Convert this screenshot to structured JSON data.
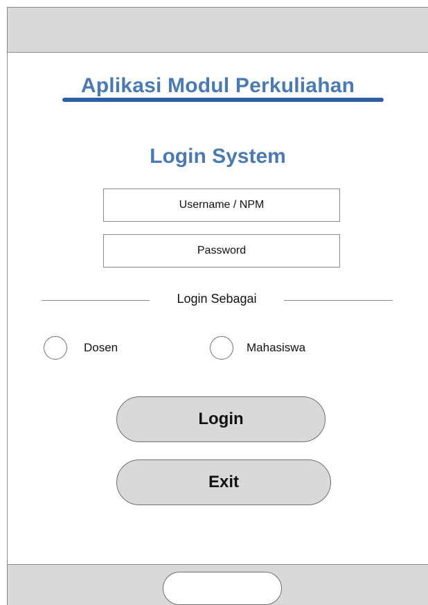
{
  "app": {
    "title": "Aplikasi Modul Perkuliahan"
  },
  "login": {
    "heading": "Login System",
    "username": {
      "value": "",
      "placeholder": "Username / NPM"
    },
    "password": {
      "value": "",
      "placeholder": "Password"
    },
    "role_section_label": "Login Sebagai",
    "roles": [
      {
        "label": "Dosen",
        "selected": false
      },
      {
        "label": "Mahasiswa",
        "selected": false
      }
    ],
    "login_button_label": "Login",
    "exit_button_label": "Exit"
  },
  "colors": {
    "title": "#4a7ab0",
    "underline": "#2f5ea6",
    "bar_background": "#d9d9d9",
    "button_background": "#d9d9d9"
  }
}
